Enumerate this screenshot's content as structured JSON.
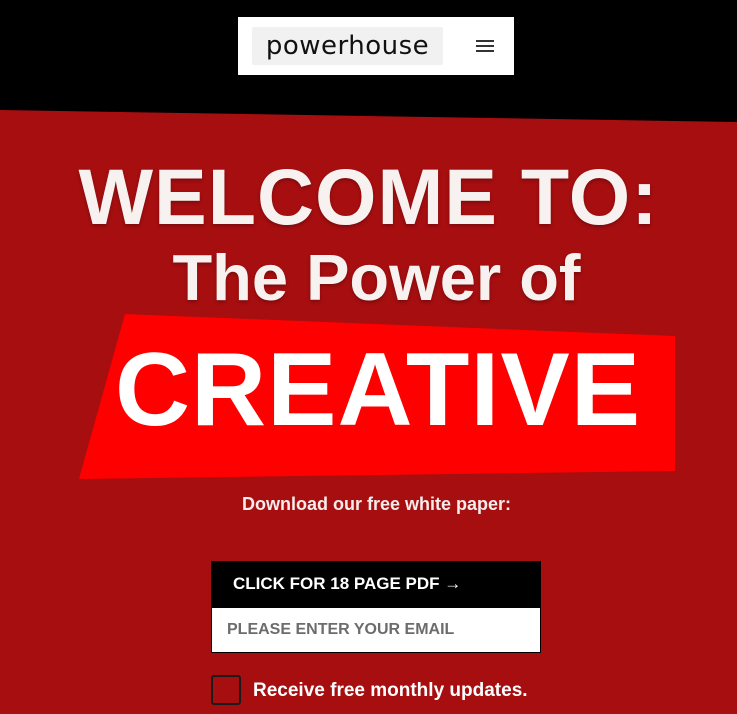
{
  "header": {
    "logo_text": "powerhouse",
    "menu_icon": "hamburger-menu-icon"
  },
  "hero": {
    "title": "WELCOME TO:",
    "subtitle": "The Power of",
    "highlight": "CREATIVE",
    "tagline": "Download our free white paper:"
  },
  "form": {
    "button_label": "CLICK FOR 18 PAGE PDF →",
    "email_placeholder": "PLEASE ENTER YOUR EMAIL",
    "email_value": "",
    "optin_label": "Receive free monthly updates."
  },
  "colors": {
    "hero_background": "#a60e10",
    "highlight_background": "#ff0000",
    "header_background": "#000000",
    "button_background": "#000000"
  }
}
